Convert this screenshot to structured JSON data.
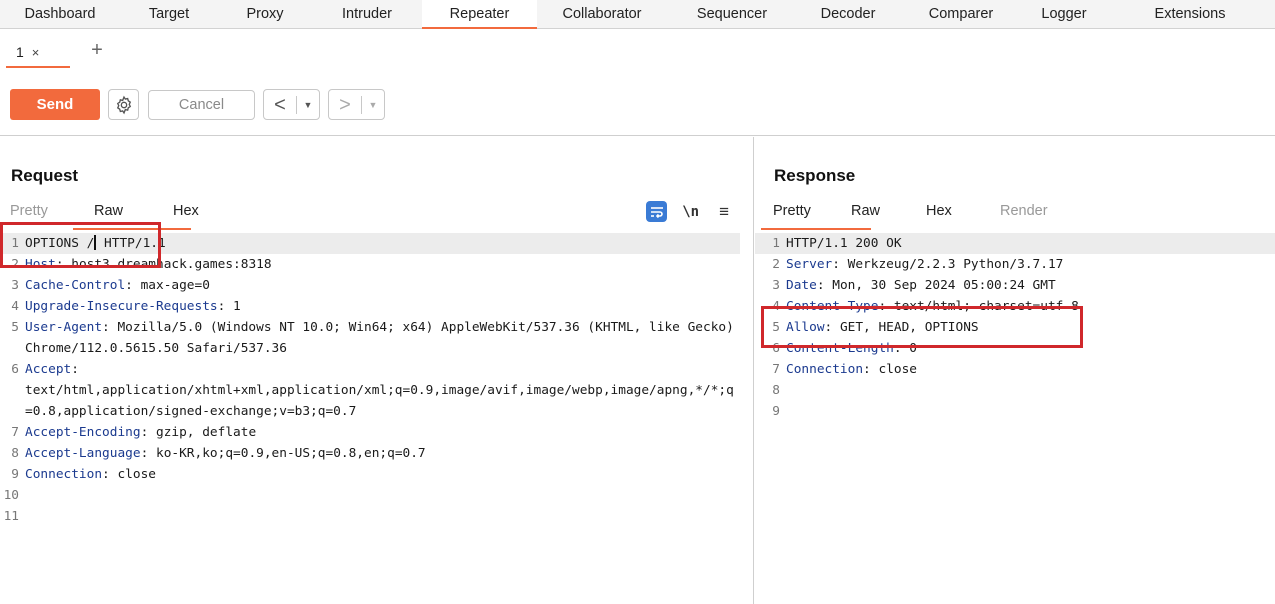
{
  "topnav": [
    "Dashboard",
    "Target",
    "Proxy",
    "Intruder",
    "Repeater",
    "Collaborator",
    "Sequencer",
    "Decoder",
    "Comparer",
    "Logger",
    "Extensions"
  ],
  "subtabs": {
    "tab_label": "1",
    "close_glyph": "×",
    "add_glyph": "+"
  },
  "toolbar": {
    "send_label": "Send",
    "cancel_label": "Cancel",
    "back_arrow": "<",
    "fwd_arrow": ">",
    "dropdown_glyph": "▼"
  },
  "request": {
    "title": "Request",
    "tabs": [
      "Pretty",
      "Raw",
      "Hex"
    ],
    "active_tab": "Raw",
    "tools": {
      "newline_label": "\\n",
      "menu_glyph": "≡"
    },
    "lines": [
      {
        "n": "1",
        "key": "",
        "value": "OPTIONS /",
        "value2": " HTTP/1.1"
      },
      {
        "n": "2",
        "key": "Host",
        "value": ": host3.dreamhack.games:8318"
      },
      {
        "n": "3",
        "key": "Cache-Control",
        "value": ": max-age=0"
      },
      {
        "n": "4",
        "key": "Upgrade-Insecure-Requests",
        "value": ": 1"
      },
      {
        "n": "5",
        "key": "User-Agent",
        "value": ": Mozilla/5.0 (Windows NT 10.0; Win64; x64) AppleWebKit/537.36 (KHTML, like Gecko) Chrome/112.0.5615.50 Safari/537.36"
      },
      {
        "n": "6",
        "key": "Accept",
        "value": ":\ntext/html,application/xhtml+xml,application/xml;q=0.9,image/avif,image/webp,image/apng,*/*;q=0.8,application/signed-exchange;v=b3;q=0.7"
      },
      {
        "n": "7",
        "key": "Accept-Encoding",
        "value": ": gzip, deflate"
      },
      {
        "n": "8",
        "key": "Accept-Language",
        "value": ": ko-KR,ko;q=0.9,en-US;q=0.8,en;q=0.7"
      },
      {
        "n": "9",
        "key": "Connection",
        "value": ": close"
      },
      {
        "n": "10",
        "key": "",
        "value": ""
      },
      {
        "n": "11",
        "key": "",
        "value": ""
      }
    ]
  },
  "response": {
    "title": "Response",
    "tabs": [
      "Pretty",
      "Raw",
      "Hex",
      "Render"
    ],
    "active_tab": "Pretty",
    "lines": [
      {
        "n": "1",
        "key": "",
        "value": "HTTP/1.1 200 OK"
      },
      {
        "n": "2",
        "key": "Server",
        "value": ": Werkzeug/2.2.3 Python/3.7.17"
      },
      {
        "n": "3",
        "key": "Date",
        "value": ": Mon, 30 Sep 2024 05:00:24 GMT"
      },
      {
        "n": "4",
        "key": "Content-Type",
        "value": ": text/html; charset=utf-8"
      },
      {
        "n": "5",
        "key": "Allow",
        "value": ": GET, HEAD, OPTIONS"
      },
      {
        "n": "6",
        "key": "Content-Length",
        "value": ": 0"
      },
      {
        "n": "7",
        "key": "Connection",
        "value": ": close"
      },
      {
        "n": "8",
        "key": "",
        "value": ""
      },
      {
        "n": "9",
        "key": "",
        "value": ""
      }
    ]
  },
  "colors": {
    "accent": "#f26a3d",
    "annotation": "#d0282b",
    "header_key": "#1b3a8f",
    "wrap_icon": "#3a7bd5"
  }
}
